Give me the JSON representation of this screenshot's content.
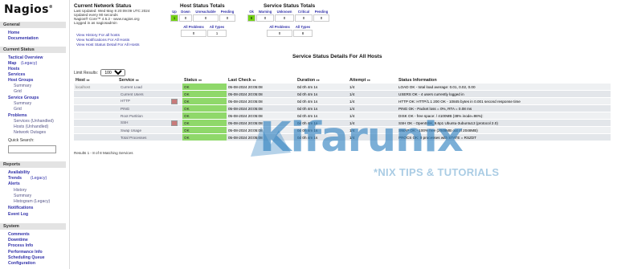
{
  "logo": {
    "text": "Nagios",
    "reg": "®"
  },
  "sidebar": {
    "general_title": "General",
    "general": [
      "Home",
      "Documentation"
    ],
    "current_title": "Current Status",
    "current": {
      "tactical": "Tactical Overview",
      "map": "Map",
      "legacy": "(Legacy)",
      "hosts": "Hosts",
      "services": "Services",
      "host_groups": "Host Groups",
      "hg_summary": "Summary",
      "hg_grid": "Grid",
      "service_groups": "Service Groups",
      "sg_summary": "Summary",
      "sg_grid": "Grid",
      "problems": "Problems",
      "pr_services": "Services (Unhandled)",
      "pr_hosts": "Hosts (Unhandled)",
      "pr_network": "Network Outages",
      "quick_search": "Quick Search:"
    },
    "reports_title": "Reports",
    "reports": {
      "availability": "Availability",
      "trends": "Trends",
      "trends_legacy": "(Legacy)",
      "alerts": "Alerts",
      "al_history": "History",
      "al_summary": "Summary",
      "al_histogram": "Histogram (Legacy)",
      "notifications": "Notifications",
      "event_log": "Event Log"
    },
    "system_title": "System",
    "system": [
      "Comments",
      "Downtime",
      "Process Info",
      "Performance Info",
      "Scheduling Queue",
      "Configuration"
    ]
  },
  "network_status": {
    "title": "Current Network Status",
    "updated": "Last Updated: Wed May 8 20:09:09 UTC 2024",
    "every": "Updated every 90 seconds",
    "version": "Nagios® Core™ 4.5.2 - www.nagios.org",
    "logged": "Logged in as nagiosadmin",
    "links": [
      "View History For all hosts",
      "View Notifications For All Hosts",
      "View Host Status Detail For All Hosts"
    ]
  },
  "host_totals": {
    "title": "Host Status Totals",
    "headers": [
      "Up",
      "Down",
      "Unreachable",
      "Pending"
    ],
    "values": [
      "1",
      "0",
      "0",
      "0"
    ],
    "headers2": [
      "All Problems",
      "All Types"
    ],
    "values2": [
      "0",
      "1"
    ]
  },
  "service_totals": {
    "title": "Service Status Totals",
    "headers": [
      "Ok",
      "Warning",
      "Unknown",
      "Critical",
      "Pending"
    ],
    "values": [
      "8",
      "0",
      "0",
      "0",
      "0"
    ],
    "headers2": [
      "All Problems",
      "All Types"
    ],
    "values2": [
      "0",
      "8"
    ]
  },
  "page_title": "Service Status Details For All Hosts",
  "limit": {
    "label": "Limit Results:",
    "value": "100"
  },
  "table": {
    "columns": [
      "Host",
      "Service",
      "Status",
      "Last Check",
      "Duration",
      "Attempt",
      "Status Information"
    ],
    "arrows": "♦♦",
    "rows": [
      {
        "host": "localhost",
        "service": "Current Load",
        "status": "OK",
        "last": "05-08-2024 20:05:08",
        "duration": "0d 0h 4m 1s",
        "attempt": "1/4",
        "info": "LOAD OK - total load average: 0.01, 0.02, 0.00",
        "icon": false
      },
      {
        "host": "",
        "service": "Current Users",
        "status": "OK",
        "last": "05-08-2024 20:05:08",
        "duration": "0d 0h 4m 1s",
        "attempt": "1/4",
        "info": "USERS OK - 4 users currently logged in",
        "icon": false
      },
      {
        "host": "",
        "service": "HTTP",
        "status": "OK",
        "last": "05-08-2024 20:05:08",
        "duration": "0d 0h 4m 1s",
        "attempt": "1/4",
        "info": "HTTP OK: HTTP/1.1 200 OK - 10845 bytes in 0.001 second response time",
        "icon": true
      },
      {
        "host": "",
        "service": "PING",
        "status": "OK",
        "last": "05-08-2024 20:05:08",
        "duration": "0d 0h 4m 1s",
        "attempt": "1/4",
        "info": "PING OK - Packet loss = 0%, RTA = 0.08 ms",
        "icon": false
      },
      {
        "host": "",
        "service": "Root Partition",
        "status": "OK",
        "last": "05-08-2024 20:05:08",
        "duration": "0d 0h 4m 1s",
        "attempt": "1/4",
        "info": "DISK OK - free space: / 4100MB (38% inode=98%):",
        "icon": false
      },
      {
        "host": "",
        "service": "SSH",
        "status": "OK",
        "last": "05-08-2024 20:05:08",
        "duration": "0d 0h 4m 1s",
        "attempt": "1/4",
        "info": "SSH OK - OpenSSH_9.6p1 Ubuntu-3ubuntu13 (protocol 2.0)",
        "icon": true
      },
      {
        "host": "",
        "service": "Swap Usage",
        "status": "OK",
        "last": "05-08-2024 20:05:08",
        "duration": "0d 0h 4m 1s",
        "attempt": "1/4",
        "info": "SWAP OK - 100% free (2048MB out of 2048MB)",
        "icon": false
      },
      {
        "host": "",
        "service": "Total Processes",
        "status": "OK",
        "last": "05-08-2024 20:05:08",
        "duration": "0d 0h 4m 1s",
        "attempt": "1/4",
        "info": "PROCS OK: 0 processes with STATE = RSZDT",
        "icon": false
      }
    ]
  },
  "results": "Results 1 - 8 of 8 Matching Services",
  "watermark": {
    "brand": "Kifarunix",
    "tagline": "*NIX TIPS & TUTORIALS"
  },
  "colors": {
    "ok": "#8fd86a",
    "accent": "#33a",
    "watermark": "#2c7fbf"
  }
}
